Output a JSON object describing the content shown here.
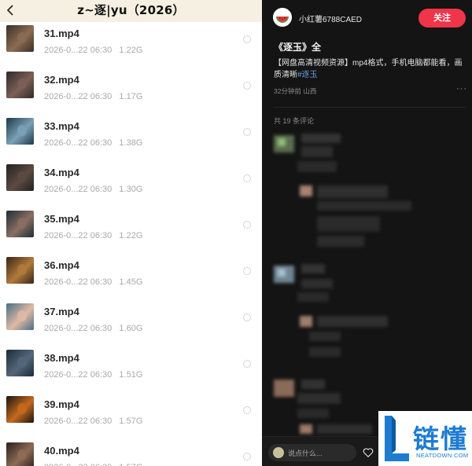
{
  "left": {
    "folder_title": "z~逐|yu（2026）",
    "files": [
      {
        "name": "31.mp4",
        "date": "2026-0...22 06:30",
        "size": "1.22G",
        "colors": [
          "#3a2f28",
          "#8b6c52"
        ]
      },
      {
        "name": "32.mp4",
        "date": "2026-0...22 06:30",
        "size": "1.17G",
        "colors": [
          "#2f2a2a",
          "#7d5f55"
        ]
      },
      {
        "name": "33.mp4",
        "date": "2026-0...22 06:30",
        "size": "1.38G",
        "colors": [
          "#1f3848",
          "#7aa1b8"
        ]
      },
      {
        "name": "34.mp4",
        "date": "2026-0...22 06:30",
        "size": "1.30G",
        "colors": [
          "#222222",
          "#5c4a40"
        ]
      },
      {
        "name": "35.mp4",
        "date": "2026-0...22 06:30",
        "size": "1.22G",
        "colors": [
          "#1d2c3a",
          "#8a6f60"
        ]
      },
      {
        "name": "36.mp4",
        "date": "2026-0...22 06:30",
        "size": "1.45G",
        "colors": [
          "#3a2418",
          "#b07a3c"
        ]
      },
      {
        "name": "37.mp4",
        "date": "2026-0...22 06:30",
        "size": "1.60G",
        "colors": [
          "#466f86",
          "#e0b9a3"
        ]
      },
      {
        "name": "38.mp4",
        "date": "2026-0...22 06:30",
        "size": "1.51G",
        "colors": [
          "#1e2b38",
          "#54677a"
        ]
      },
      {
        "name": "39.mp4",
        "date": "2026-0...22 06:30",
        "size": "1.57G",
        "colors": [
          "#1a1410",
          "#c46a1e"
        ]
      },
      {
        "name": "40.mp4",
        "date": "2026-0...22 06:30",
        "size": "1.57G",
        "colors": [
          "#2a211d",
          "#8e6b55"
        ]
      }
    ]
  },
  "right": {
    "username": "小红薯6788CAED",
    "follow_label": "关注",
    "post_title": "《逐玉》全",
    "post_body": "【网盘高清视频资源】mp4格式，手机电脑都能看，画质清晰",
    "hashtag": "#逐玉",
    "post_time": "32分钟前",
    "post_location": "山西",
    "more_icon": "···",
    "comment_count": "共 19 条评论",
    "comment_placeholder": "说点什么...",
    "accent_color": "#f0344a"
  },
  "watermark": {
    "cn": "链懂",
    "en": "NEATDOWN.COM"
  }
}
